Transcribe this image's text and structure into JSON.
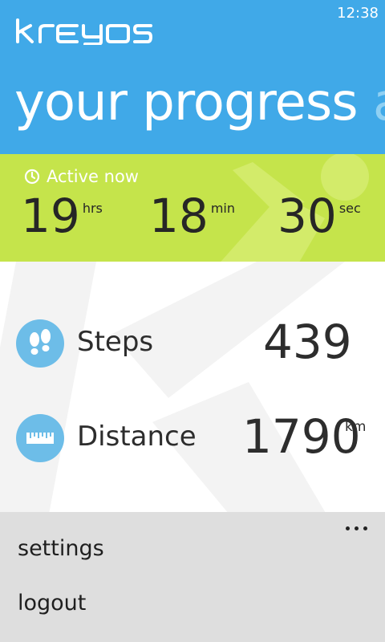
{
  "status_bar": {
    "time": "12:38"
  },
  "header": {
    "logo_text": "kreyos",
    "title": "your progress",
    "title_next_fragment": "ac"
  },
  "active": {
    "label": "Active now",
    "hours": {
      "value": "19",
      "unit": "hrs"
    },
    "minutes": {
      "value": "18",
      "unit": "min"
    },
    "seconds": {
      "value": "30",
      "unit": "sec"
    }
  },
  "stats": [
    {
      "label": "Steps",
      "value": "439",
      "unit": "",
      "icon": "footsteps-icon"
    },
    {
      "label": "Distance",
      "value": "1790",
      "unit": "km",
      "icon": "ruler-icon"
    }
  ],
  "menu": {
    "items": [
      "settings",
      "logout"
    ]
  },
  "colors": {
    "header_bg": "#40a9e8",
    "active_bg": "#c5e44b",
    "icon_circle": "#6dbde8",
    "menu_bg": "#dedede"
  }
}
